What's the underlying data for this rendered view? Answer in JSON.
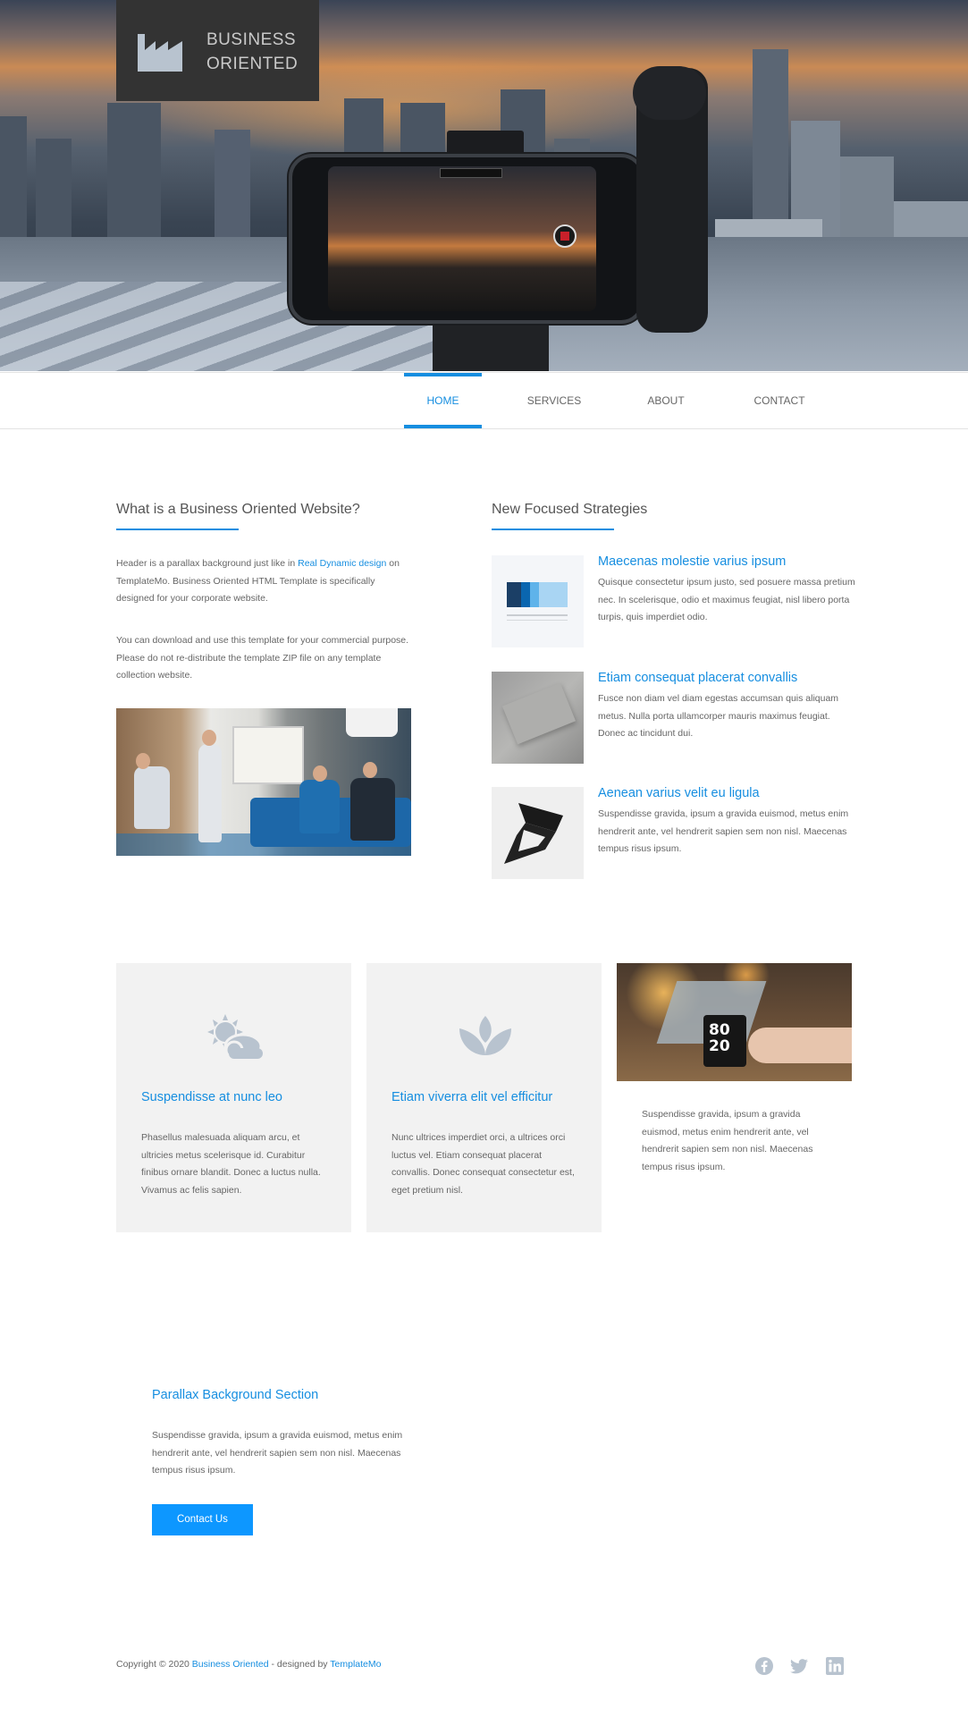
{
  "brand": {
    "name": "BUSINESS\nORIENTED",
    "icon": "factory-icon"
  },
  "nav": {
    "items": [
      {
        "label": "HOME",
        "active": true
      },
      {
        "label": "SERVICES",
        "active": false
      },
      {
        "label": "ABOUT",
        "active": false
      },
      {
        "label": "CONTACT",
        "active": false
      }
    ]
  },
  "intro": {
    "title": "What is a Business Oriented Website?",
    "p1_before": "Header is a parallax background just like in ",
    "p1_link": "Real Dynamic design",
    "p1_after": " on TemplateMo. Business Oriented HTML Template is specifically designed for your corporate website.",
    "p2": "You can download and use this template for your commercial purpose. Please do not re-distribute the template ZIP file on any template collection website."
  },
  "strategies": {
    "title": "New Focused Strategies",
    "items": [
      {
        "title": "Maecenas molestie varius ipsum",
        "text": "Quisque consectetur ipsum justo, sed posuere massa pretium nec. In scelerisque, odio et maximus feugiat, nisl libero porta turpis, quis imperdiet odio."
      },
      {
        "title": "Etiam consequat placerat convallis",
        "text": "Fusce non diam vel diam egestas accumsan quis aliquam metus. Nulla porta ullamcorper mauris maximus feugiat. Donec ac tincidunt dui."
      },
      {
        "title": "Aenean varius velit eu ligula",
        "text": "Suspendisse gravida, ipsum a gravida euismod, metus enim hendrerit ante, vel hendrerit sapien sem non nisl. Maecenas tempus risus ipsum."
      }
    ]
  },
  "features": [
    {
      "icon": "sun-cloud-icon",
      "title": "Suspendisse at nunc leo",
      "text": "Phasellus malesuada aliquam arcu, et ultricies metus scelerisque id. Curabitur finibus ornare blandit. Donec a luctus nulla. Vivamus ac felis sapien."
    },
    {
      "icon": "lotus-icon",
      "title": "Etiam viverra elit vel efficitur",
      "text": "Nunc ultrices imperdiet orci, a ultrices orci luctus vel. Etiam consequat placerat convallis. Donec consequat consectetur est, eget pretium nisl."
    }
  ],
  "mug_photo": {
    "mug_text": "80\n20"
  },
  "mug_text": "Suspendisse gravida, ipsum a gravida euismod, metus enim hendrerit ante, vel hendrerit sapien sem non nisl. Maecenas tempus risus ipsum.",
  "parallax": {
    "title": "Parallax Background Section",
    "text": "Suspendisse gravida, ipsum a gravida euismod, metus enim hendrerit ante, vel hendrerit sapien sem non nisl. Maecenas tempus risus ipsum.",
    "button": "Contact Us"
  },
  "footer": {
    "prefix": "Copyright © 2020 ",
    "brand_link": "Business Oriented",
    "middle": " - designed by ",
    "designer_link": "TemplateMo",
    "social": [
      "facebook-icon",
      "twitter-icon",
      "linkedin-icon"
    ]
  },
  "colors": {
    "accent": "#168ee0",
    "button": "#0d97ff",
    "card_bg": "#f2f2f2",
    "icon_grey": "#b8c3cf",
    "brand_bg": "#333333"
  }
}
